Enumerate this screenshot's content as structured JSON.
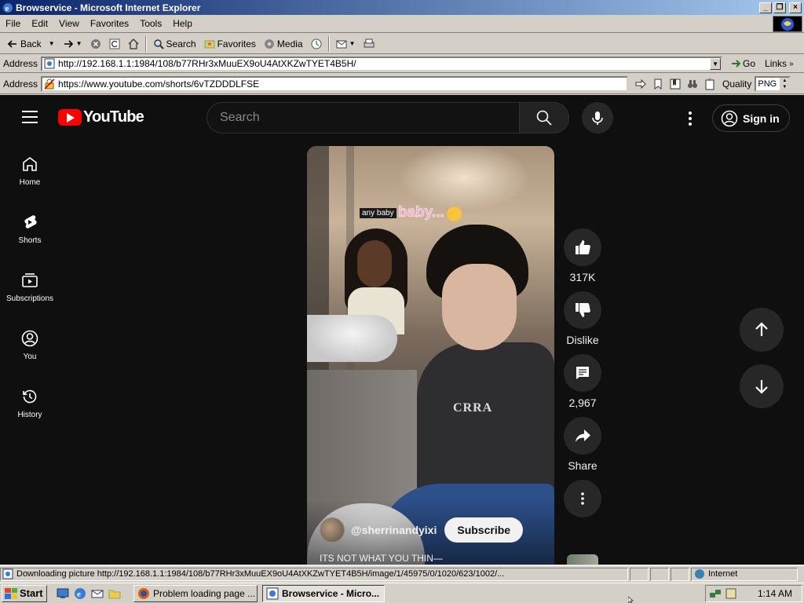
{
  "window": {
    "title": "Browservice - Microsoft Internet Explorer",
    "buttons": {
      "minimize": "_",
      "restore": "❐",
      "close": "×"
    }
  },
  "menu": [
    "File",
    "Edit",
    "View",
    "Favorites",
    "Tools",
    "Help"
  ],
  "toolbar": {
    "back": "Back",
    "search": "Search",
    "favorites": "Favorites",
    "media": "Media"
  },
  "address_bar": {
    "label": "Address",
    "url": "http://192.168.1.1:1984/108/b77RHr3xMuuEX9oU4AtXKZwTYET4B5H/",
    "go": "Go",
    "links": "Links"
  },
  "inner_address": {
    "label": "Address",
    "url": "https://www.youtube.com/shorts/6vTZDDDLFSE",
    "quality_label": "Quality",
    "quality_value": "PNG"
  },
  "youtube": {
    "logo": "YouTube",
    "search_placeholder": "Search",
    "sign_in": "Sign in",
    "sidebar": [
      {
        "label": "Home"
      },
      {
        "label": "Shorts"
      },
      {
        "label": "Subscriptions"
      },
      {
        "label": "You"
      },
      {
        "label": "History"
      }
    ],
    "video": {
      "caption_small": "any baby",
      "caption_big": "baby...",
      "shirt_print": "CRRA",
      "channel": "@sherrinandyixi",
      "subscribe": "Subscribe",
      "title": "ITS NOT WHAT YOU THIN—"
    },
    "actions": {
      "likes": "317K",
      "dislike": "Dislike",
      "comments": "2,967",
      "share": "Share"
    }
  },
  "status": {
    "text": "Downloading picture http://192.168.1.1:1984/108/b77RHr3xMuuEX9oU4AtXKZwTYET4B5H/image/1/45975/0/1020/623/1002/...",
    "zone": "Internet"
  },
  "taskbar": {
    "start": "Start",
    "tasks": [
      "Problem loading page ...",
      "Browservice - Micro..."
    ],
    "clock": "1:14 AM"
  },
  "colors": {
    "yt_bg": "#0f0f0f",
    "yt_red": "#ff0000",
    "title_gradient_start": "#0a246a",
    "title_gradient_end": "#a6caf0",
    "win_face": "#d4d0c8"
  }
}
